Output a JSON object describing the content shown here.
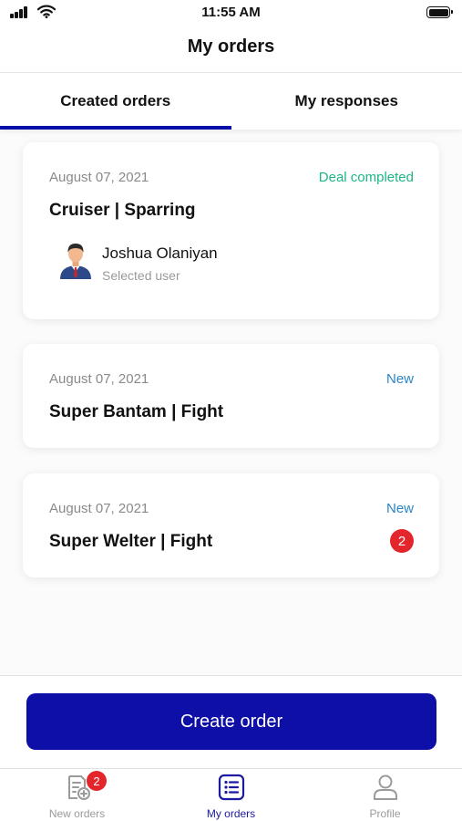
{
  "status_bar": {
    "time": "11:55 AM"
  },
  "header": {
    "title": "My orders"
  },
  "tabs": [
    {
      "label": "Created orders",
      "active": true
    },
    {
      "label": "My responses",
      "active": false
    }
  ],
  "orders": [
    {
      "date": "August 07, 2021",
      "status": "Deal completed",
      "title": "Cruiser | Sparring",
      "user": {
        "name": "Joshua Olaniyan",
        "role": "Selected user"
      }
    },
    {
      "date": "August 07, 2021",
      "status": "New",
      "title": "Super Bantam | Fight"
    },
    {
      "date": "August 07, 2021",
      "status": "New",
      "title": "Super Welter | Fight",
      "badge": "2"
    }
  ],
  "actions": {
    "create_label": "Create order"
  },
  "nav": {
    "items": [
      {
        "label": "New orders",
        "icon": "new-orders-icon",
        "badge": "2"
      },
      {
        "label": "My orders",
        "icon": "list-icon",
        "active": true
      },
      {
        "label": "Profile",
        "icon": "user-icon"
      }
    ]
  },
  "colors": {
    "primary": "#0e0fa6",
    "deal_completed": "#1fb48a",
    "new": "#2b86c5",
    "badge": "#e3262c"
  }
}
